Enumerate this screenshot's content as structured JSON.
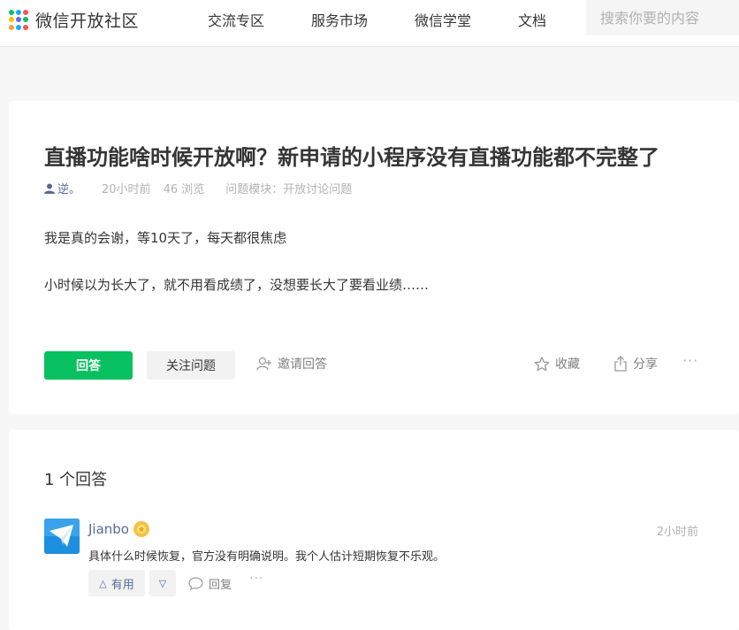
{
  "header": {
    "logo_text": "微信开放社区",
    "nav": [
      "交流专区",
      "服务市场",
      "微信学堂",
      "文档"
    ],
    "search_placeholder": "搜索你要的内容"
  },
  "question": {
    "title": "直播功能啥时候开放啊？新申请的小程序没有直播功能都不完整了",
    "author": "逆。",
    "time": "20小时前",
    "views": "46 浏览",
    "module": "问题模块：开放讨论问题",
    "paragraphs": [
      "我是真的会谢，等10天了，每天都很焦虑",
      "小时候以为长大了，就不用看成绩了，没想要长大了要看业绩……"
    ],
    "actions": {
      "answer": "回答",
      "follow": "关注问题",
      "invite": "邀请回答",
      "collect": "收藏",
      "share": "分享",
      "more": "···"
    }
  },
  "answers": {
    "count_label": "1 个回答",
    "items": [
      {
        "author": "Jianbo",
        "time": "2小时前",
        "text": "具体什么时候恢复，官方没有明确说明。我个人估计短期恢复不乐观。",
        "useful_label": "有用",
        "reply_label": "回复",
        "more": "···"
      }
    ]
  },
  "colors": {
    "brand_green": "#07c160",
    "link_blue": "#576b95",
    "muted": "#b2b2b2"
  }
}
